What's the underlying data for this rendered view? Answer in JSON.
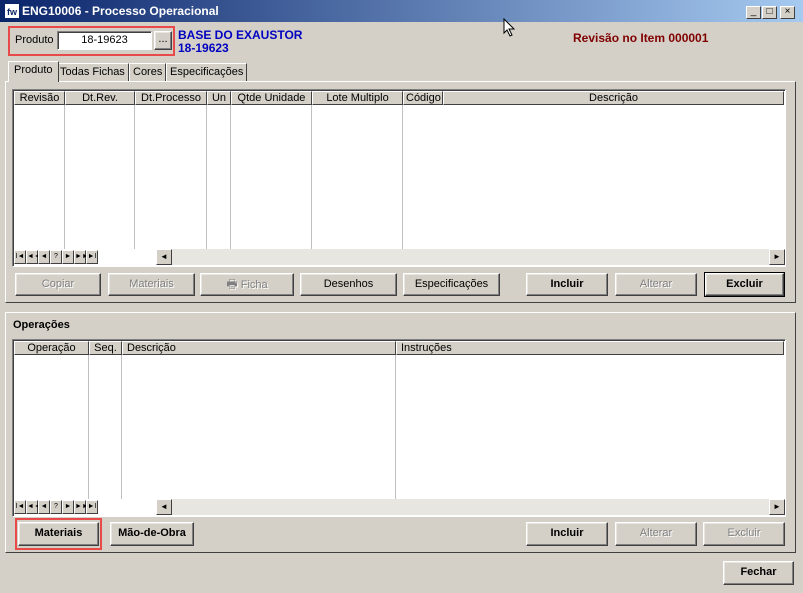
{
  "window": {
    "icon_text": "fw",
    "title": "ENG10006 - Processo Operacional",
    "controls": [
      "_",
      "□",
      "×"
    ]
  },
  "produto": {
    "label": "Produto",
    "value": "18-19623",
    "lookup_label": "...",
    "description": "BASE DO EXAUSTOR",
    "code": "18-19623",
    "revisao_text": "Revisão no Item 000001"
  },
  "tabs": [
    "Produto",
    "Todas Fichas",
    "Cores",
    "Especificações"
  ],
  "revisions_grid": {
    "columns": [
      "Revisão",
      "Dt.Rev.",
      "Dt.Processo",
      "Un",
      "Qtde Unidade",
      "Lote Multiplo",
      "Código",
      "Descrição"
    ],
    "nav": [
      "I◄",
      "◄◄",
      "◄",
      "?",
      "►",
      "►►",
      "►I"
    ]
  },
  "top_buttons": {
    "copiar": "Copiar",
    "materiais": "Materiais",
    "ficha": "Ficha",
    "desenhos": "Desenhos",
    "especificacoes": "Especificações",
    "incluir": "Incluir",
    "alterar": "Alterar",
    "excluir": "Excluir"
  },
  "operacoes": {
    "heading": "Operações",
    "columns": [
      "Operação",
      "Seq.",
      "Descrição",
      "Instruções"
    ],
    "nav": [
      "I◄",
      "◄◄",
      "◄",
      "?",
      "►",
      "►►",
      "►I"
    ]
  },
  "bottom_buttons": {
    "materiais": "Materiais",
    "mao_de_obra": "Mão-de-Obra",
    "incluir": "Incluir",
    "alterar": "Alterar",
    "excluir": "Excluir"
  },
  "footer": {
    "fechar": "Fechar"
  },
  "colors": {
    "title_start": "#0a246a",
    "title_end": "#a6caf0",
    "desc_blue": "#0000c0",
    "revisao_red": "#800000",
    "highlight": "#e84a4a"
  }
}
